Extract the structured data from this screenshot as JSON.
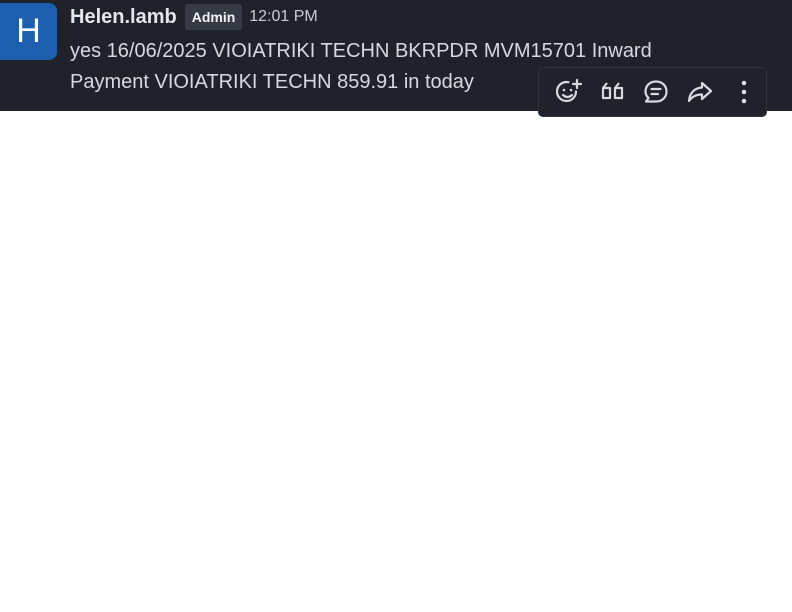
{
  "message": {
    "avatar_letter": "H",
    "avatar_color": "#1d5fae",
    "username": "Helen.lamb",
    "role_badge": "Admin",
    "time": "12:01 PM",
    "text_line1": "yes 16/06/2025 VIOIATRIKI TECHN BKRPDR MVM15701 Inward",
    "text_line2": "Payment VIOIATRIKI TECHN 859.91 in today"
  },
  "toolbar": {
    "actions": [
      {
        "icon": "add-reaction-icon"
      },
      {
        "icon": "quote-icon"
      },
      {
        "icon": "reply-in-thread-icon"
      },
      {
        "icon": "forward-icon"
      },
      {
        "icon": "more-options-icon"
      }
    ]
  },
  "colors": {
    "message_background": "#1f222a",
    "page_background": "#ffffff",
    "text": "#d6d9de"
  }
}
